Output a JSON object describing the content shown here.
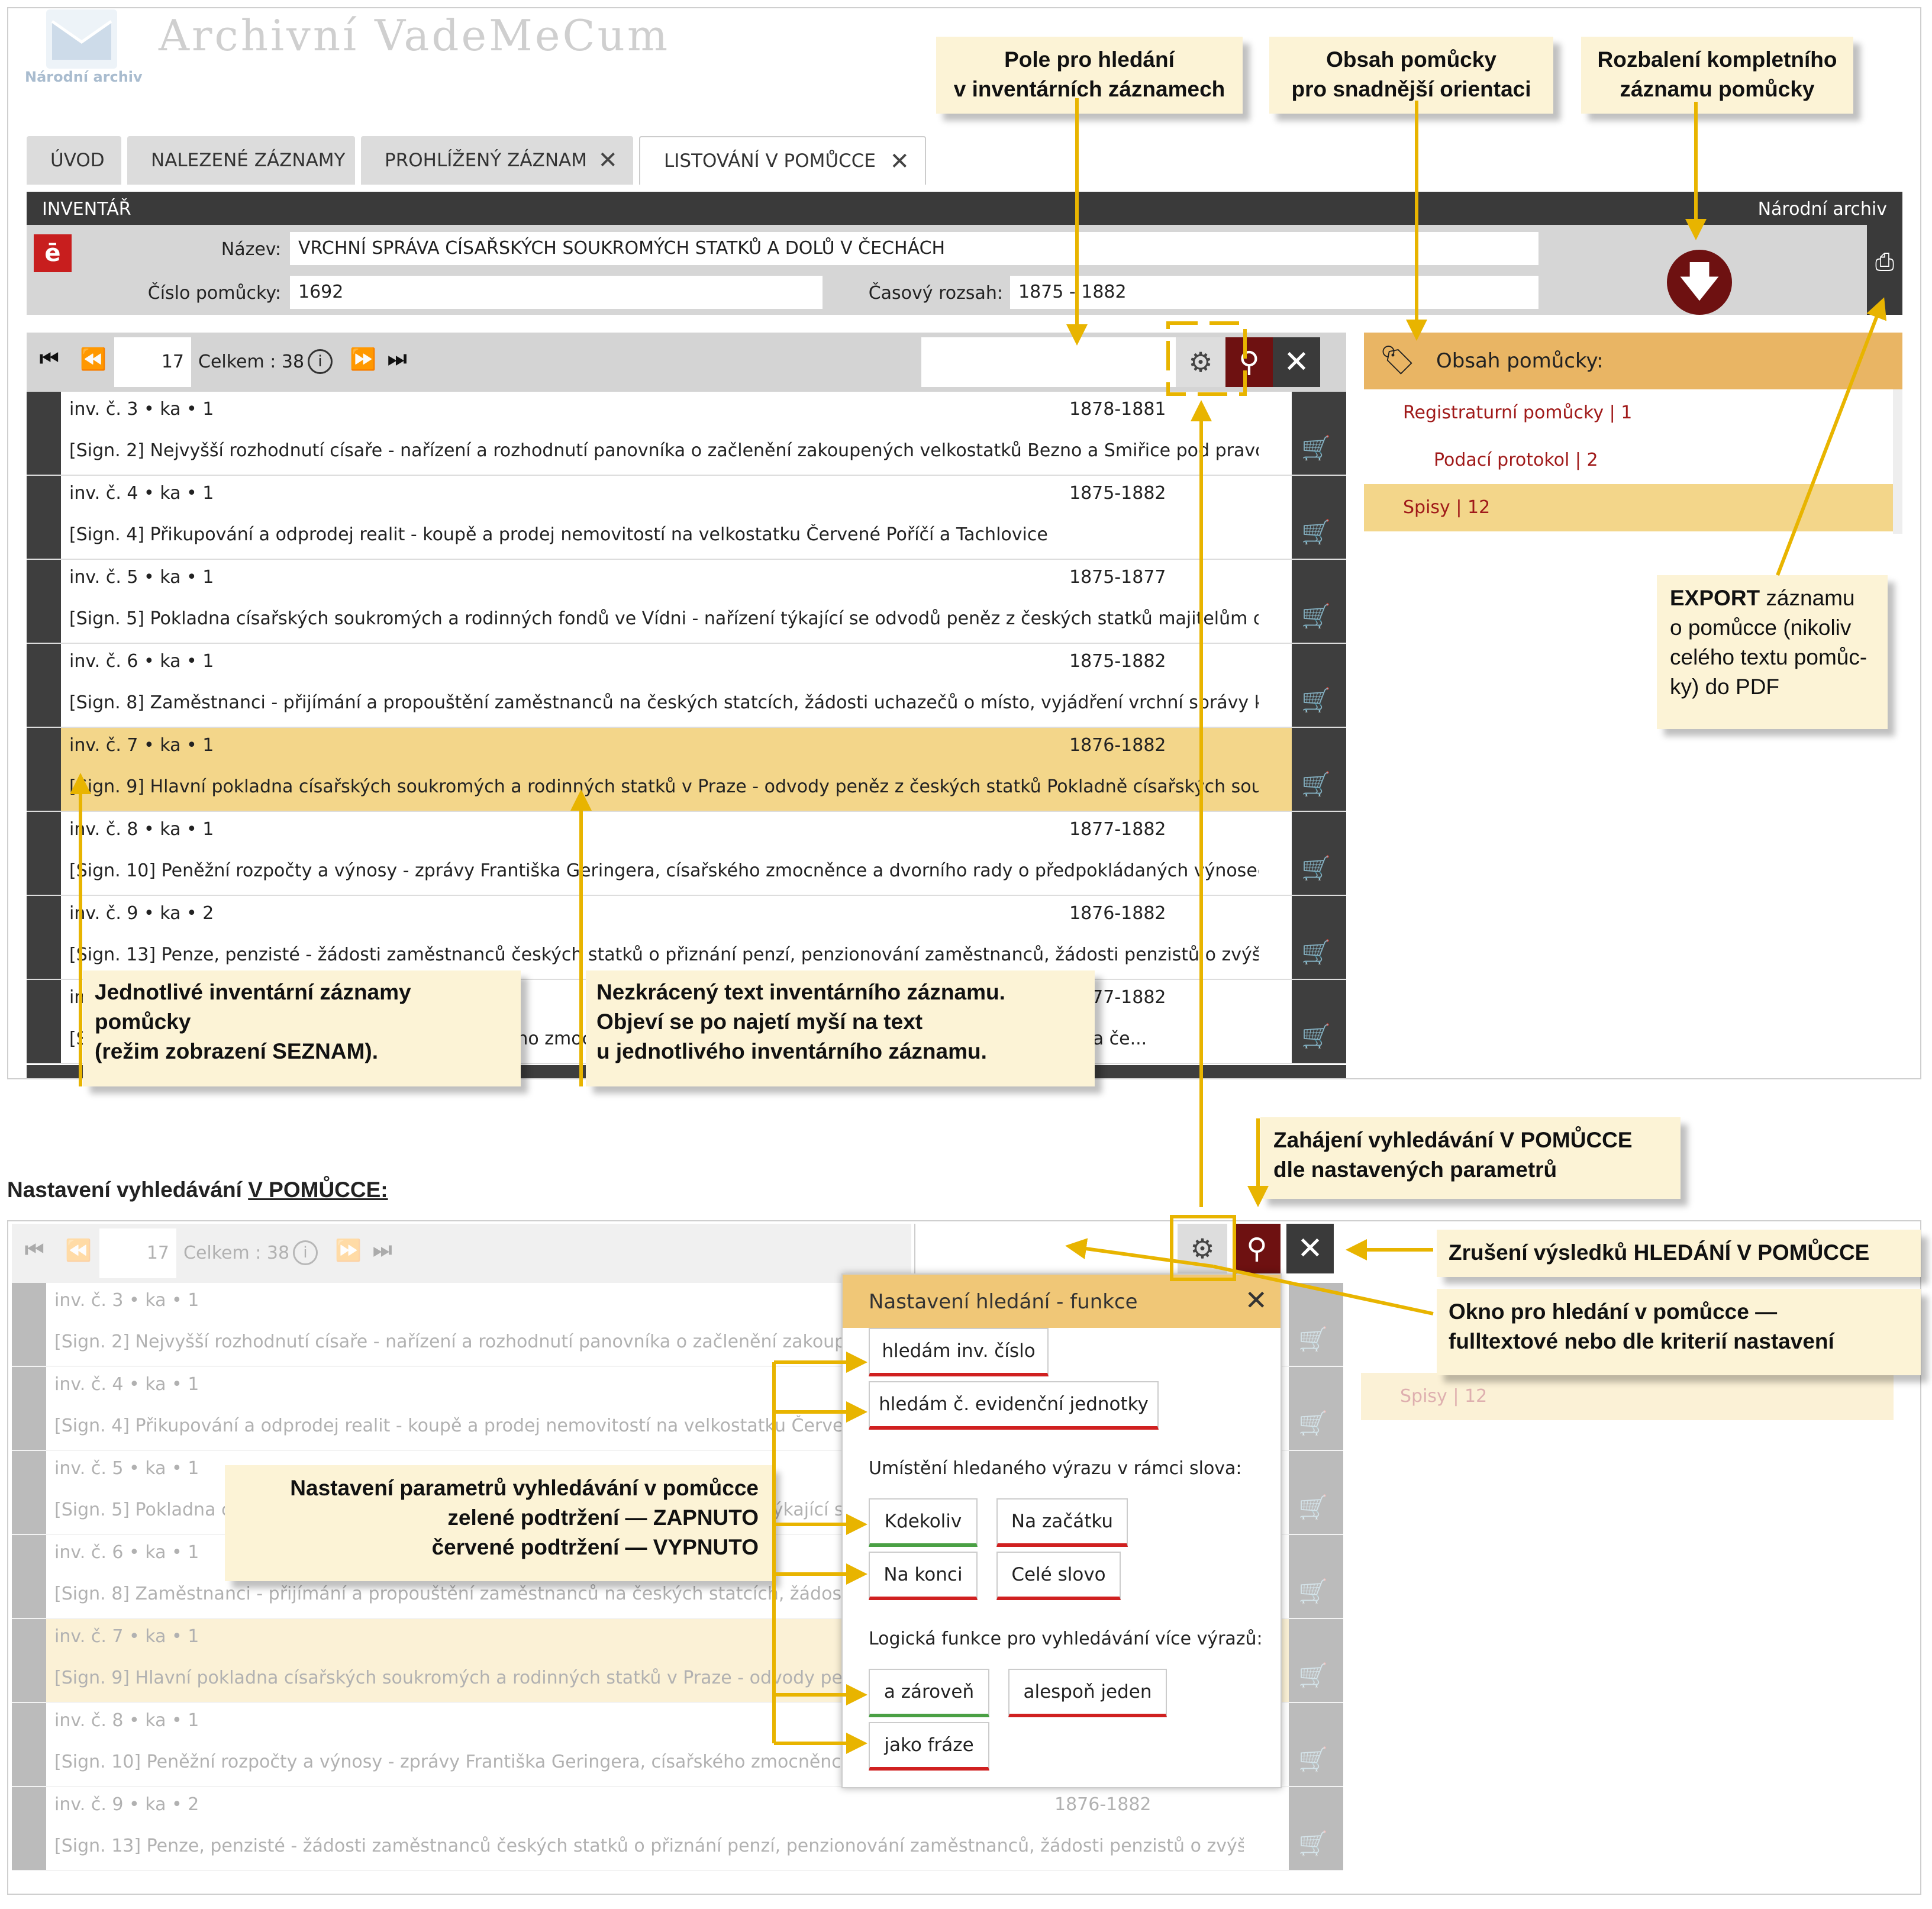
{
  "app": {
    "title": "Archivní VadeMeCum",
    "logo_text": "Národní archiv"
  },
  "tabs": [
    {
      "label": "ÚVOD"
    },
    {
      "label": "NALEZENÉ ZÁZNAMY"
    },
    {
      "label": "PROHLÍŽENÝ ZÁZNAM"
    },
    {
      "label": "LISTOVÁNÍ V POMŮCCE"
    }
  ],
  "header": {
    "section": "INVENTÁŘ",
    "archive": "Národní archiv"
  },
  "inventory": {
    "name_label": "Název:",
    "name_value": "VRCHNÍ SPRÁVA CÍSAŘSKÝCH SOUKROMÝCH STATKŮ A DOLŮ V ČECHÁCH",
    "number_label": "Číslo pomůcky:",
    "number_value": "1692",
    "range_label": "Časový rozsah:",
    "range_value": "1875 - 1882"
  },
  "pager": {
    "page": "17",
    "total_label": "Celkem : 38"
  },
  "rows": [
    {
      "inv": "inv. č. 3 • ka • 1",
      "date": "1878-1881",
      "text": "[Sign. 2] Nejvyšší rozhodnutí císaře - nařízení a rozhodnutí panovníka o začlenění zakoupených velkostatků Bezno a Smiřice pod pravomoc V..."
    },
    {
      "inv": "inv. č. 4 • ka • 1",
      "date": "1875-1882",
      "text": "[Sign. 4] Přikupování a odprodej realit - koupě a prodej nemovitostí na velkostatku Červené Poříčí a Tachlovice"
    },
    {
      "inv": "inv. č. 5 • ka • 1",
      "date": "1875-1877",
      "text": "[Sign. 5] Pokladna císařských soukromých a rodinných fondů ve Vídni - nařízení týkající se odvodů peněz z českých statků majitelům do Vídně"
    },
    {
      "inv": "inv. č. 6 • ka • 1",
      "date": "1875-1882",
      "text": "[Sign. 8] Zaměstnanci - přijímání a propouštění zaměstnanců na českých statcích, žádosti uchazečů o místo, vyjádření vrchní správy k žádos..."
    },
    {
      "inv": "inv. č. 7 • ka • 1",
      "date": "1876-1882",
      "text": "[Sign. 9] Hlavní pokladna císařských soukromých a rodinných statků v Praze - odvody peněz z českých statků Pokladně císařských soukromýc..."
    },
    {
      "inv": "inv. č. 8 • ka • 1",
      "date": "1877-1882",
      "text": "[Sign. 10] Peněžní rozpočty a výnosy - zprávy Františka Geringera, císařského zmocněnce a dvorního rady o předpokládaných výnosech česk..."
    },
    {
      "inv": "inv. č. 9 • ka • 2",
      "date": "1876-1882",
      "text": "[Sign. 13] Penze, penzisté - žádosti zaměstnanců českých statků o přiznání penzí, penzionování zaměstnanců, žádosti penzistů o zvýšení pe..."
    },
    {
      "inv": "inv. č. 10 • ka • 2",
      "date": "1877-1882",
      "text": "[Sign. 14] Záležitosti Františka Geringera, císařského zmocněnce a dvorního rady o vyřizování různých záležitostí na če..."
    }
  ],
  "lower_extra_text": "[Sign. 14] ...ringera ...ch záležitostí na če...",
  "side": {
    "title": "Obsah pomůcky:",
    "items": [
      {
        "label": "Registraturní pomůcky | 1"
      },
      {
        "label": "Podací protokol | 2"
      },
      {
        "label": "Spisy | 12"
      }
    ]
  },
  "section2_title_pre": "Nastavení vyhledávání ",
  "section2_title_u": "V POMŮCCE:",
  "popup": {
    "title": "Nastavení hledání - funkce",
    "btn_inv": "hledám inv. číslo",
    "btn_ej": "hledám č. evidenční jednotky",
    "pos_label": "Umístění hledaného výrazu v rámci slova:",
    "pos": [
      "Kdekoliv",
      "Na začátku",
      "Na konci",
      "Celé slovo"
    ],
    "logic_label": "Logická funkce pro vyhledávání více výrazů:",
    "logic": [
      "a zároveň",
      "alespoň jeden",
      "jako fráze"
    ]
  },
  "callouts": {
    "search_field": [
      "Pole pro hledání",
      "v inventárních záznamech"
    ],
    "contents": [
      "Obsah pomůcky",
      "pro snadnější orientaci"
    ],
    "expand": [
      "Rozbalení kompletního",
      "záznamu pomůcky"
    ],
    "export_bold": "EXPORT",
    "export_rest": [
      " záznamu",
      "o pomůcce (nikoliv",
      "celého textu pomůc-",
      "ky) do PDF"
    ],
    "records": [
      "Jednotlivé inventární záznamy",
      "pomůcky",
      "(režim zobrazení SEZNAM)."
    ],
    "fulltext": [
      "Nezkrácený text inventárního záznamu.",
      "Objeví se po najetí myší na text",
      "u jednotlivého inventárního záznamu."
    ],
    "start_search": [
      "Zahájení vyhledávání V POMŮCCE",
      "dle nastavených parametrů"
    ],
    "cancel": "Zrušení výsledků HLEDÁNÍ V POMŮCCE",
    "window": [
      "Okno pro hledání v pomůcce —",
      "fulltextové nebo dle kriterií nastavení"
    ],
    "params": [
      "Nastavení parametrů vyhledávání v pomůcce",
      "zelené podtržení — ZAPNUTO",
      "červené podtržení — VYPNUTO"
    ]
  },
  "colors": {
    "accent_yellow": "#e8b400",
    "dark_red": "#6e1111",
    "highlight": "#f3d68a",
    "green": "#4aa044",
    "red": "#d02020"
  }
}
